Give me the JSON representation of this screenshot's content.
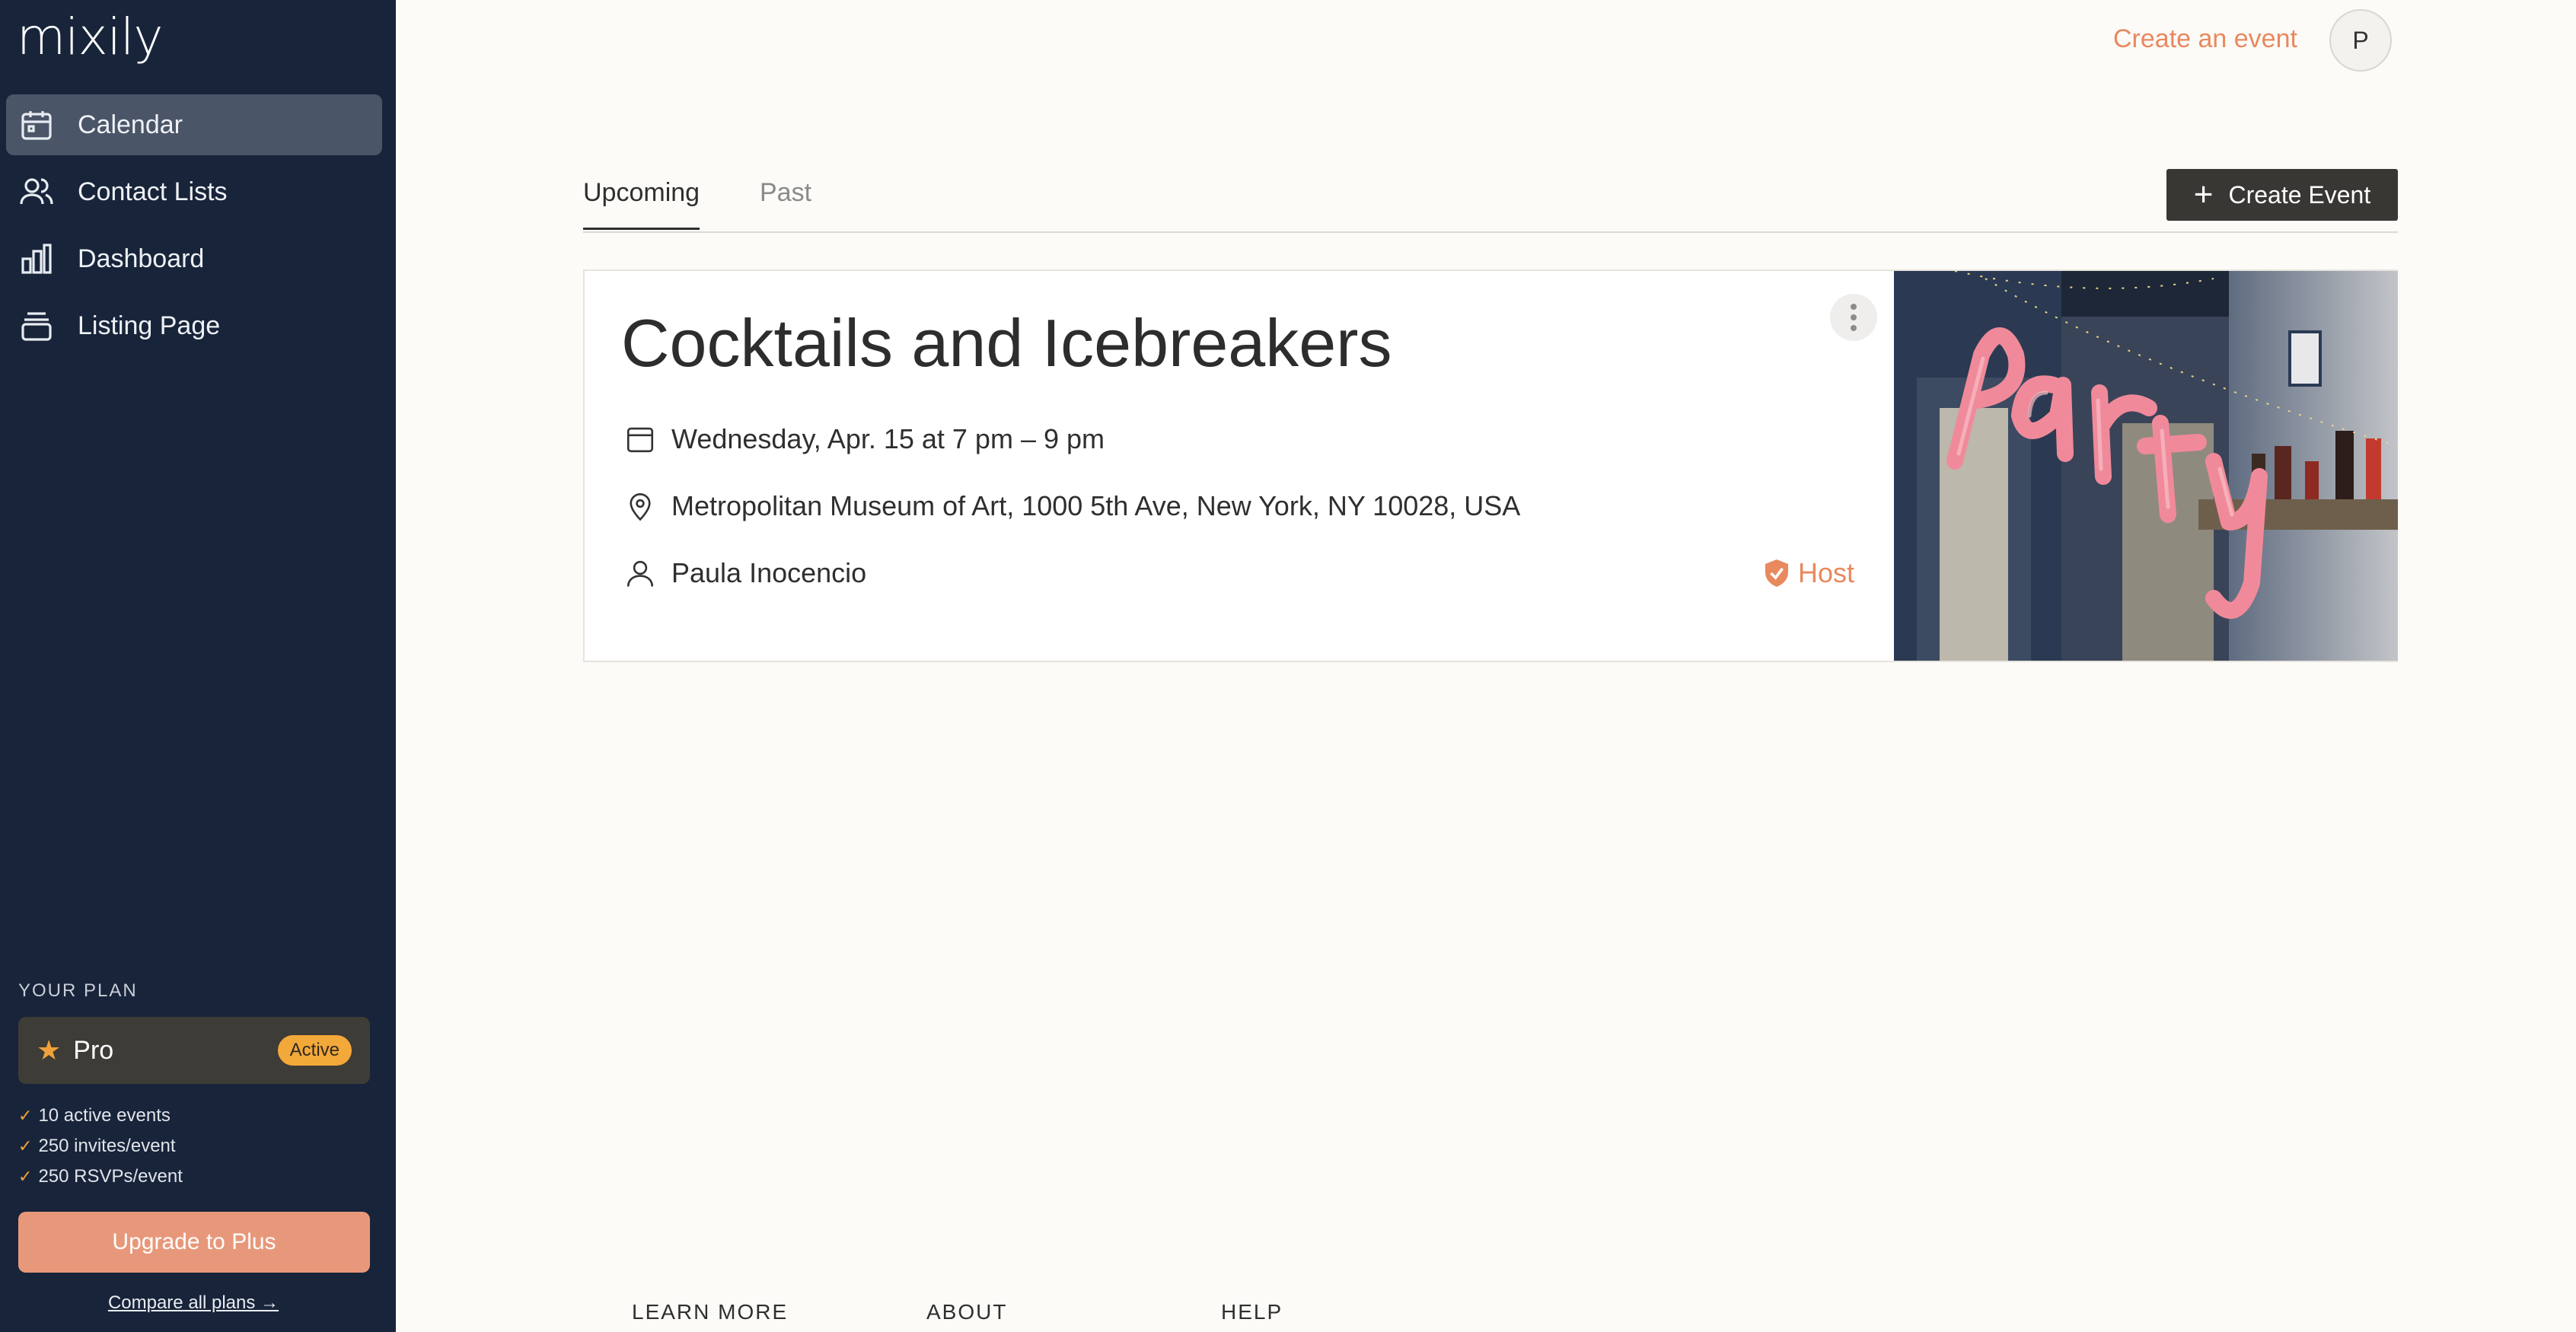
{
  "app": {
    "logo": "mixily"
  },
  "sidebar": {
    "items": [
      {
        "label": "Calendar",
        "icon": "calendar-icon",
        "active": true
      },
      {
        "label": "Contact Lists",
        "icon": "users-icon",
        "active": false
      },
      {
        "label": "Dashboard",
        "icon": "bar-chart-icon",
        "active": false
      },
      {
        "label": "Listing Page",
        "icon": "layers-icon",
        "active": false
      }
    ],
    "plan": {
      "heading": "YOUR PLAN",
      "name": "Pro",
      "badge": "Active",
      "features": [
        "10 active events",
        "250 invites/event",
        "250 RSVPs/event"
      ],
      "upgrade_label": "Upgrade to Plus",
      "compare_label": "Compare all plans →"
    }
  },
  "header": {
    "create_link": "Create an event",
    "avatar_initial": "P"
  },
  "tabs": {
    "upcoming": "Upcoming",
    "past": "Past",
    "active": "Upcoming"
  },
  "toolbar": {
    "create_event_label": "Create Event"
  },
  "event": {
    "title": "Cocktails and Icebreakers",
    "datetime": "Wednesday, Apr. 15 at 7 pm – 9 pm",
    "location": "Metropolitan Museum of Art, 1000 5th Ave, New York, NY 10028, USA",
    "host_name": "Paula Inocencio",
    "role": "Host",
    "image_text": "party"
  },
  "footer": {
    "columns": [
      "LEARN MORE",
      "ABOUT",
      "HELP"
    ]
  },
  "colors": {
    "sidebar_bg": "#18243a",
    "accent": "#e8895e",
    "plan_badge": "#f3a83a",
    "upgrade_button": "#e8987a",
    "page_bg": "#fcfbf8"
  }
}
